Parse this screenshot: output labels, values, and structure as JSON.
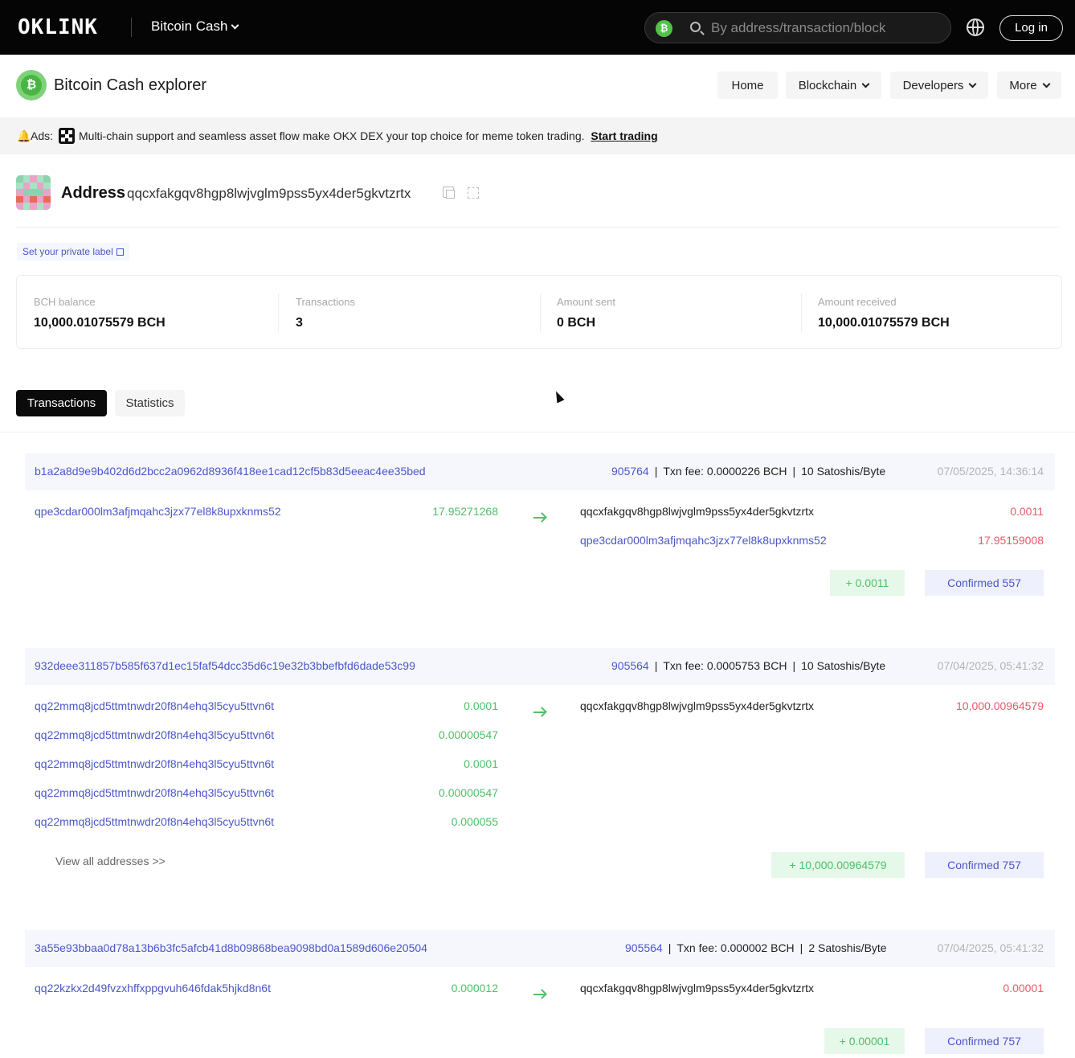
{
  "topbar": {
    "logo_letters": [
      "O",
      "K",
      "L",
      "I",
      "N",
      "K"
    ],
    "chain": "Bitcoin Cash",
    "search_placeholder": "By address/transaction/block",
    "login_label": "Log in"
  },
  "subnav": {
    "title": "Bitcoin Cash explorer",
    "items": [
      {
        "label": "Home"
      },
      {
        "label": "Blockchain"
      },
      {
        "label": "Developers"
      },
      {
        "label": "More"
      }
    ]
  },
  "ads": {
    "label": "Ads:",
    "message": "Multi-chain support and seamless asset flow make OKX DEX your top choice for meme token trading.",
    "cta": "Start trading"
  },
  "address": {
    "title": "Address",
    "hash": "qqcxfakgqv8hgp8lwjvglm9pss5yx4der5gkvtzrtx",
    "private_label": "Set your private label"
  },
  "stats": [
    {
      "label": "BCH balance",
      "value": "10,000.01075579 BCH"
    },
    {
      "label": "Transactions",
      "value": "3"
    },
    {
      "label": "Amount sent",
      "value": "0 BCH"
    },
    {
      "label": "Amount received",
      "value": "10,000.01075579 BCH"
    }
  ],
  "tabs": [
    {
      "label": "Transactions"
    },
    {
      "label": "Statistics"
    }
  ],
  "transactions": [
    {
      "hash": "b1a2a8d9e9b402d6d2bcc2a0962d8936f418ee1cad12cf5b83d5eeac4ee35bed",
      "block": "905764",
      "fee": "Txn fee: 0.0000226 BCH",
      "rate": "10 Satoshis/Byte",
      "time": "07/05/2025, 14:36:14",
      "inputs": [
        {
          "addr": "qpe3cdar000lm3afjmqahc3jzx77el8k8upxknms52",
          "amount": "17.95271268"
        }
      ],
      "outputs": [
        {
          "addr": "qqcxfakgqv8hgp8lwjvglm9pss5yx4der5gkvtzrtx",
          "amount": "0.0011",
          "self": true
        },
        {
          "addr": "qpe3cdar000lm3afjmqahc3jzx77el8k8upxknms52",
          "amount": "17.95159008",
          "self": false
        }
      ],
      "delta": "+ 0.0011",
      "confirmed": "Confirmed 557"
    },
    {
      "hash": "932deee311857b585f637d1ec15faf54dcc35d6c19e32b3bbefbfd6dade53c99",
      "block": "905564",
      "fee": "Txn fee: 0.0005753 BCH",
      "rate": "10 Satoshis/Byte",
      "time": "07/04/2025, 05:41:32",
      "inputs": [
        {
          "addr": "qq22mmq8jcd5ttmtnwdr20f8n4ehq3l5cyu5ttvn6t",
          "amount": "0.0001"
        },
        {
          "addr": "qq22mmq8jcd5ttmtnwdr20f8n4ehq3l5cyu5ttvn6t",
          "amount": "0.00000547"
        },
        {
          "addr": "qq22mmq8jcd5ttmtnwdr20f8n4ehq3l5cyu5ttvn6t",
          "amount": "0.0001"
        },
        {
          "addr": "qq22mmq8jcd5ttmtnwdr20f8n4ehq3l5cyu5ttvn6t",
          "amount": "0.00000547"
        },
        {
          "addr": "qq22mmq8jcd5ttmtnwdr20f8n4ehq3l5cyu5ttvn6t",
          "amount": "0.000055"
        }
      ],
      "outputs": [
        {
          "addr": "qqcxfakgqv8hgp8lwjvglm9pss5yx4der5gkvtzrtx",
          "amount": "10,000.00964579",
          "self": true
        }
      ],
      "view_all": "View all addresses >>",
      "delta": "+ 10,000.00964579",
      "confirmed": "Confirmed 757"
    },
    {
      "hash": "3a55e93bbaa0d78a13b6b3fc5afcb41d8b09868bea9098bd0a1589d606e20504",
      "block": "905564",
      "fee": "Txn fee: 0.000002 BCH",
      "rate": "2 Satoshis/Byte",
      "time": "07/04/2025, 05:41:32",
      "inputs": [
        {
          "addr": "qq22kzkx2d49fvzxhffxppgvuh646fdak5hjkd8n6t",
          "amount": "0.000012"
        }
      ],
      "outputs": [
        {
          "addr": "qqcxfakgqv8hgp8lwjvglm9pss5yx4der5gkvtzrtx",
          "amount": "0.00001",
          "self": true
        }
      ],
      "delta": "+ 0.00001",
      "confirmed": "Confirmed 757"
    }
  ]
}
